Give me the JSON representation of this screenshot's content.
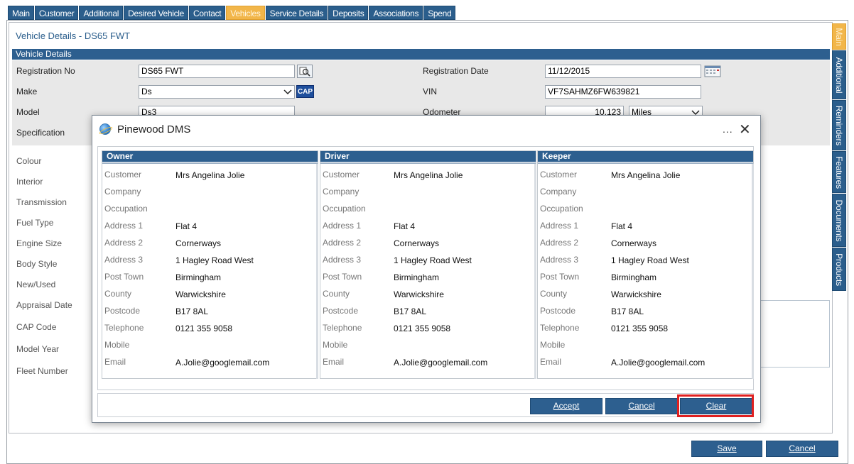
{
  "top_tabs": [
    {
      "label": "Main",
      "active": false
    },
    {
      "label": "Customer",
      "active": false
    },
    {
      "label": "Additional",
      "active": false
    },
    {
      "label": "Desired Vehicle",
      "active": false
    },
    {
      "label": "Contact",
      "active": false
    },
    {
      "label": "Vehicles",
      "active": true
    },
    {
      "label": "Service Details",
      "active": false
    },
    {
      "label": "Deposits",
      "active": false
    },
    {
      "label": "Associations",
      "active": false
    },
    {
      "label": "Spend",
      "active": false
    }
  ],
  "page_title": "Vehicle Details - DS65 FWT",
  "section_title": "Vehicle Details",
  "form": {
    "registration_no_label": "Registration No",
    "registration_no_value": "DS65 FWT",
    "registration_date_label": "Registration Date",
    "registration_date_value": "11/12/2015",
    "make_label": "Make",
    "make_value": "Ds",
    "vin_label": "VIN",
    "vin_value": "VF7SAHMZ6FW639821",
    "model_label": "Model",
    "model_value": "Ds3",
    "odometer_label": "Odometer",
    "odometer_value": "10,123",
    "odometer_unit": "Miles",
    "specification_label": "Specification",
    "cap_label": "CAP"
  },
  "left_labels": [
    "Colour",
    "Interior",
    "Transmission",
    "Fuel Type",
    "Engine Size",
    "Body Style",
    "New/Used",
    "Appraisal Date",
    "CAP Code",
    "Model Year",
    "Fleet Number"
  ],
  "side_tabs": [
    {
      "label": "Main",
      "active": true
    },
    {
      "label": "Additional",
      "active": false
    },
    {
      "label": "Reminders",
      "active": false
    },
    {
      "label": "Features",
      "active": false
    },
    {
      "label": "Documents",
      "active": false
    },
    {
      "label": "Products",
      "active": false
    }
  ],
  "footer": {
    "save": "Save",
    "cancel": "Cancel"
  },
  "modal": {
    "title": "Pinewood DMS",
    "more": "...",
    "close": "✕",
    "field_labels": [
      "Customer",
      "Company",
      "Occupation",
      "Address 1",
      "Address 2",
      "Address 3",
      "Post Town",
      "County",
      "Postcode",
      "Telephone",
      "Mobile",
      "Email"
    ],
    "columns": [
      {
        "header": "Owner",
        "values": [
          "Mrs Angelina Jolie",
          "",
          "",
          "Flat 4",
          "Cornerways",
          "1 Hagley Road West",
          "Birmingham",
          "Warwickshire",
          "B17 8AL",
          "0121 355 9058",
          "",
          "A.Jolie@googlemail.com"
        ]
      },
      {
        "header": "Driver",
        "values": [
          "Mrs Angelina Jolie",
          "",
          "",
          "Flat 4",
          "Cornerways",
          "1 Hagley Road West",
          "Birmingham",
          "Warwickshire",
          "B17 8AL",
          "0121 355 9058",
          "",
          "A.Jolie@googlemail.com"
        ]
      },
      {
        "header": "Keeper",
        "values": [
          "Mrs Angelina Jolie",
          "",
          "",
          "Flat 4",
          "Cornerways",
          "1 Hagley Road West",
          "Birmingham",
          "Warwickshire",
          "B17 8AL",
          "0121 355 9058",
          "",
          "A.Jolie@googlemail.com"
        ]
      }
    ],
    "buttons": {
      "accept": "Accept",
      "cancel": "Cancel",
      "clear": "Clear"
    }
  },
  "colors": {
    "tab_blue": "#2b5e8c",
    "tab_active": "#f2b64a",
    "highlight": "#e02020"
  }
}
